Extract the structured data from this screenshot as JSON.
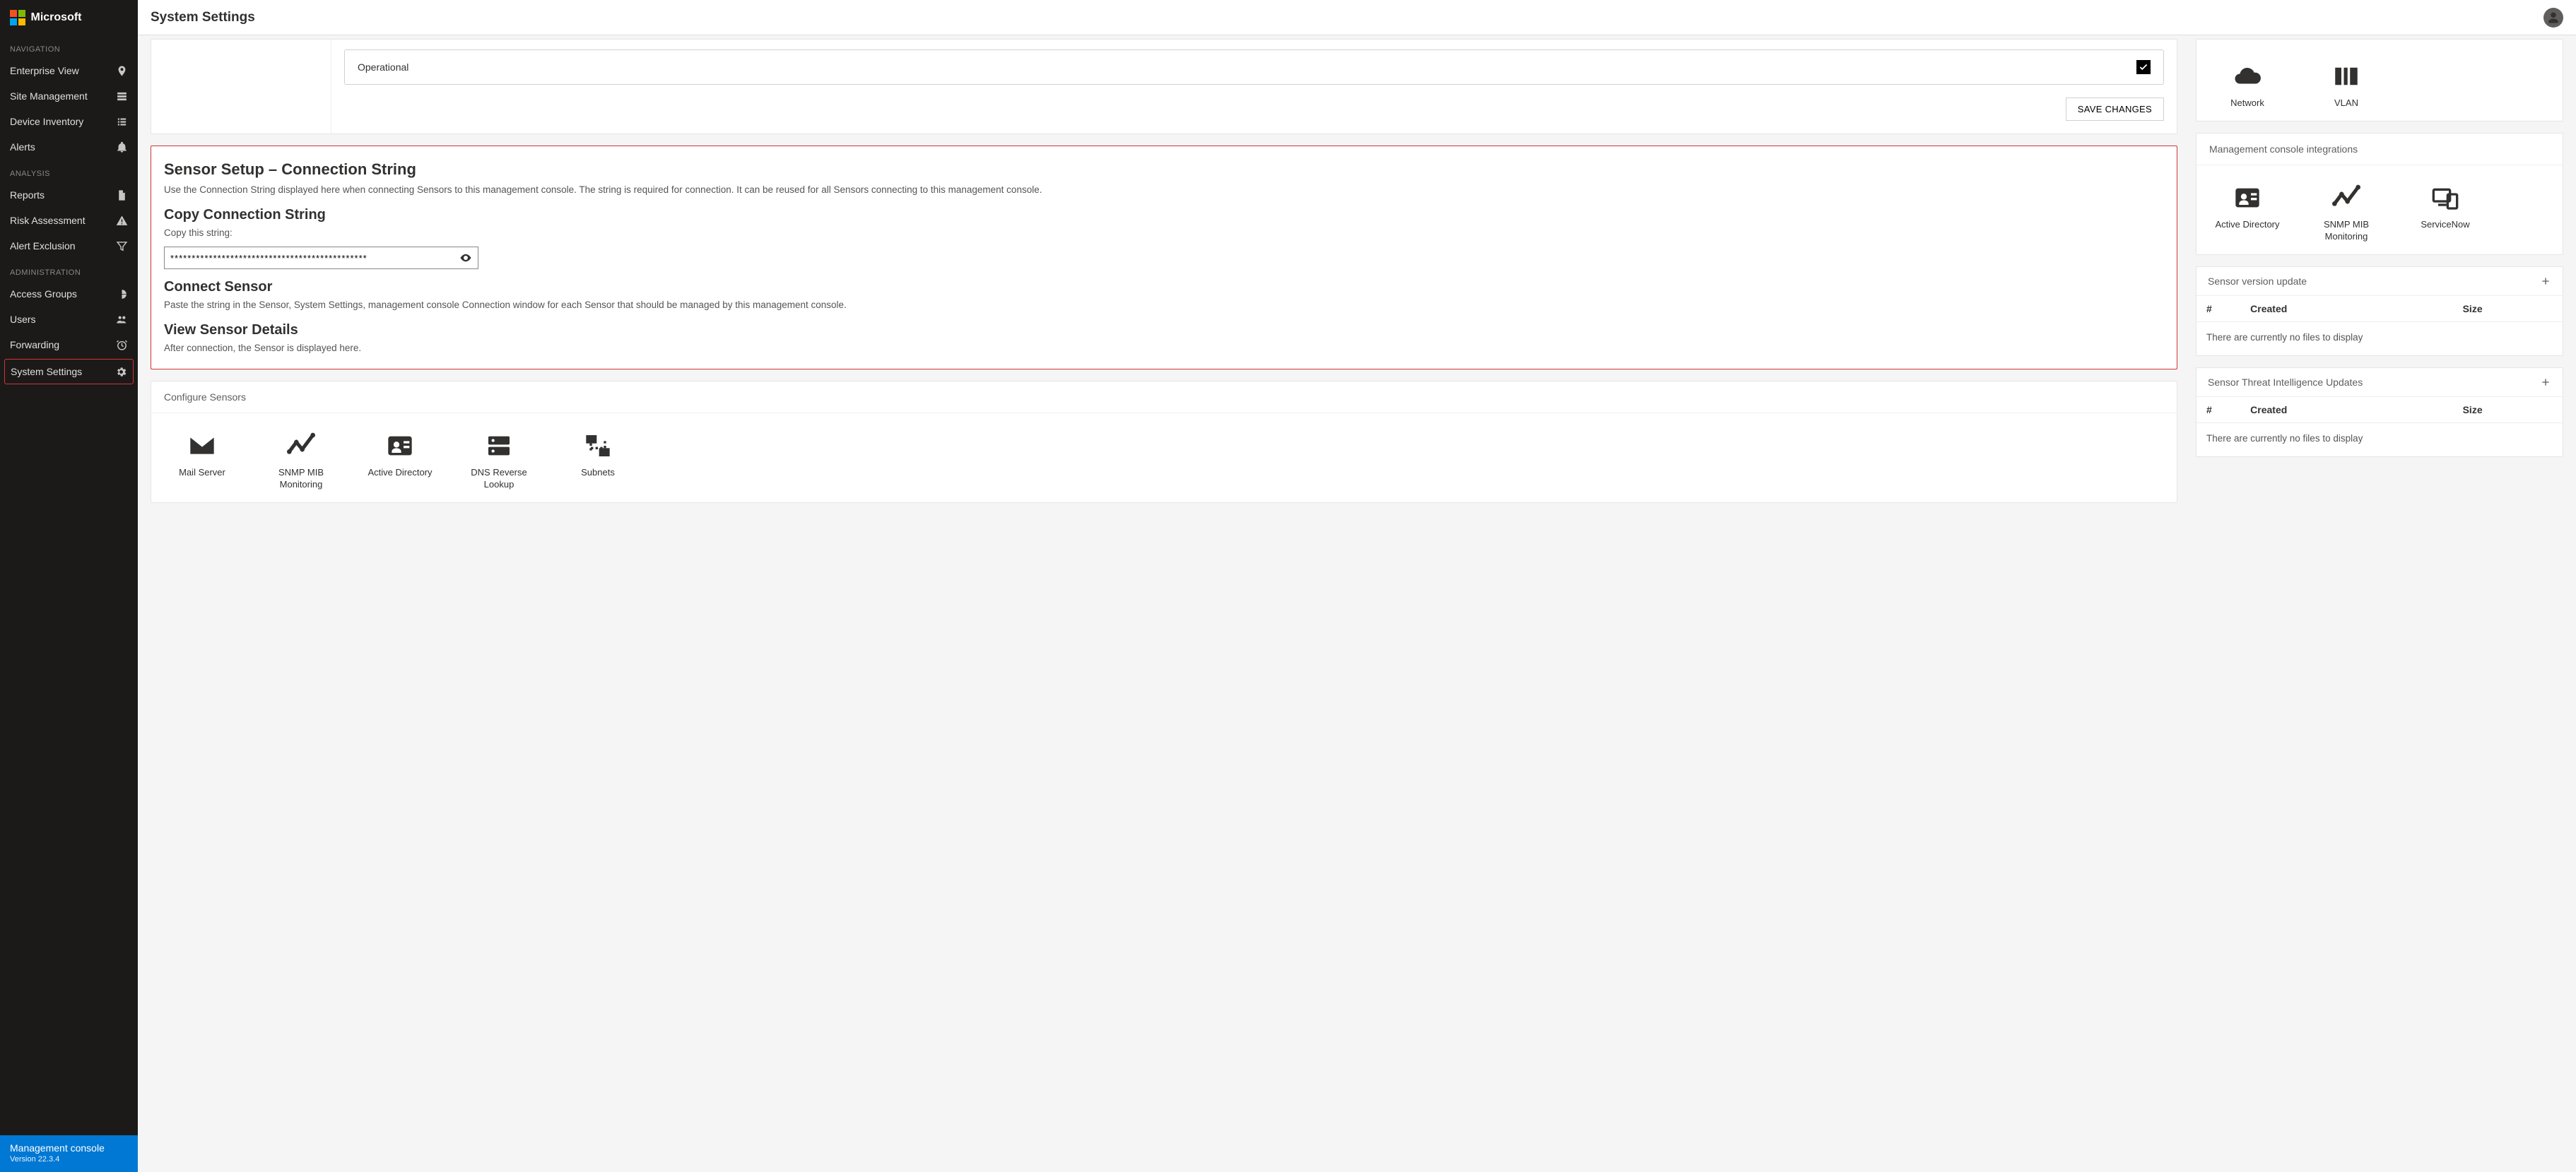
{
  "brand": "Microsoft",
  "page_title": "System Settings",
  "sidebar": {
    "sections": [
      {
        "label": "NAVIGATION",
        "items": [
          {
            "key": "enterprise-view",
            "label": "Enterprise View",
            "icon": "map-pin-icon"
          },
          {
            "key": "site-management",
            "label": "Site Management",
            "icon": "site-icon"
          },
          {
            "key": "device-inventory",
            "label": "Device Inventory",
            "icon": "list-icon"
          },
          {
            "key": "alerts",
            "label": "Alerts",
            "icon": "bell-icon"
          }
        ]
      },
      {
        "label": "ANALYSIS",
        "items": [
          {
            "key": "reports",
            "label": "Reports",
            "icon": "document-icon"
          },
          {
            "key": "risk-assessment",
            "label": "Risk Assessment",
            "icon": "warning-icon"
          },
          {
            "key": "alert-exclusion",
            "label": "Alert Exclusion",
            "icon": "filter-icon"
          }
        ]
      },
      {
        "label": "ADMINISTRATION",
        "items": [
          {
            "key": "access-groups",
            "label": "Access Groups",
            "icon": "globe-group-icon"
          },
          {
            "key": "users",
            "label": "Users",
            "icon": "people-icon"
          },
          {
            "key": "forwarding",
            "label": "Forwarding",
            "icon": "clock-icon"
          },
          {
            "key": "system-settings",
            "label": "System Settings",
            "icon": "gear-icon",
            "active": true
          }
        ]
      }
    ],
    "footer": {
      "title": "Management console",
      "version": "Version 22.3.4"
    }
  },
  "operational": {
    "label": "Operational",
    "checked": true,
    "save_label": "SAVE CHANGES"
  },
  "sensor_setup": {
    "title": "Sensor Setup – Connection String",
    "desc": "Use the Connection String displayed here when connecting Sensors to this management console. The string is required for connection. It can be reused for all Sensors connecting to this management console.",
    "copy_heading": "Copy Connection String",
    "copy_label": "Copy this string:",
    "masked_value": "**********************************************",
    "connect_heading": "Connect Sensor",
    "connect_desc": "Paste the string in the Sensor, System Settings, management console Connection window for each Sensor that should be managed by this management console.",
    "view_heading": "View Sensor Details",
    "view_desc": "After connection, the Sensor is displayed here."
  },
  "configure_sensors": {
    "title": "Configure Sensors",
    "tiles": [
      {
        "key": "mail-server",
        "label": "Mail Server",
        "icon": "mail-icon"
      },
      {
        "key": "snmp",
        "label": "SNMP MIB Monitoring",
        "icon": "trend-icon"
      },
      {
        "key": "active-directory",
        "label": "Active Directory",
        "icon": "id-card-icon"
      },
      {
        "key": "dns",
        "label": "DNS Reverse Lookup",
        "icon": "dns-icon"
      },
      {
        "key": "subnets",
        "label": "Subnets",
        "icon": "subnets-icon"
      }
    ]
  },
  "network_tiles": {
    "tiles": [
      {
        "key": "network",
        "label": "Network",
        "icon": "cloud-icon"
      },
      {
        "key": "vlan",
        "label": "VLAN",
        "icon": "vlan-icon"
      }
    ]
  },
  "integrations": {
    "title": "Management console integrations",
    "tiles": [
      {
        "key": "active-directory",
        "label": "Active Directory",
        "icon": "id-card-icon"
      },
      {
        "key": "snmp",
        "label": "SNMP MIB Monitoring",
        "icon": "trend-icon"
      },
      {
        "key": "servicenow",
        "label": "ServiceNow",
        "icon": "devices-icon"
      }
    ]
  },
  "version_update": {
    "title": "Sensor version update",
    "columns": [
      "#",
      "Created",
      "Size"
    ],
    "empty": "There are currently no files to display"
  },
  "threat_update": {
    "title": "Sensor Threat Intelligence Updates",
    "columns": [
      "#",
      "Created",
      "Size"
    ],
    "empty": "There are currently no files to display"
  }
}
